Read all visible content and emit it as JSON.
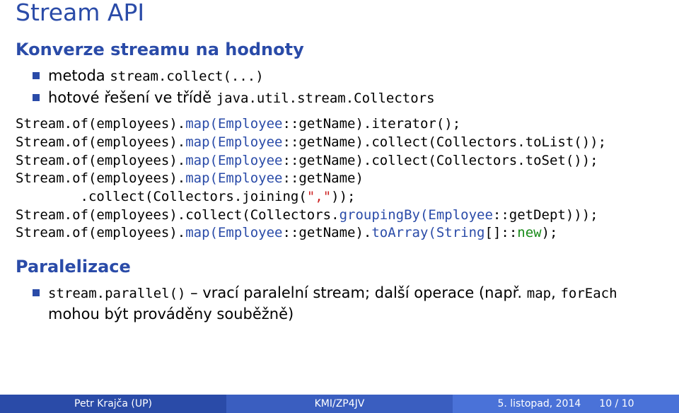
{
  "title": "Stream API",
  "section_conversion": {
    "heading": "Konverze streamu na hodnoty",
    "bullets": [
      {
        "prefix": "metoda ",
        "code": "stream.collect(...)"
      },
      {
        "prefix": "hotové řešení ve třídě ",
        "code": "java.util.stream.Collectors"
      }
    ]
  },
  "code": {
    "l1": {
      "a": "Stream.of(employees).",
      "b": "map(Employee",
      "c": "::getName).iterator();"
    },
    "l2": {
      "a": "Stream.of(employees).",
      "b": "map(Employee",
      "c": "::getName).collect(Collectors.toList());"
    },
    "l3": {
      "a": "Stream.of(employees).",
      "b": "map(Employee",
      "c": "::getName).collect(Collectors.toSet());"
    },
    "l4": {
      "a": "Stream.of(employees).",
      "b": "map(Employee",
      "c": "::getName)"
    },
    "l5": {
      "a": "        .collect(Collectors.joining(",
      "b": "\",\"",
      "c": "));"
    },
    "l6": {
      "a": "Stream.of(employees).collect(Collectors.",
      "b": "groupingBy(Employee",
      "c": "::getDept)));"
    },
    "l7": {
      "a": "Stream.of(employees).",
      "b": "map(Employee",
      "c": "::getName).",
      "d": "toArray(String",
      "e": "[]::",
      "f": "new",
      "g": ");"
    }
  },
  "section_parallel": {
    "heading": "Paralelizace",
    "bullet": {
      "code1": "stream.parallel()",
      "txt1": " – vrací paralelní stream; další operace (např. ",
      "code2": "map",
      "txt2": ", ",
      "code3": "forEach",
      "txt3": "mohou být prováděny souběžně)"
    }
  },
  "footer": {
    "author": "Petr Krajča (UP)",
    "course": "KMI/ZP4JV",
    "date": "5. listopad, 2014",
    "page": "10 / 10"
  }
}
